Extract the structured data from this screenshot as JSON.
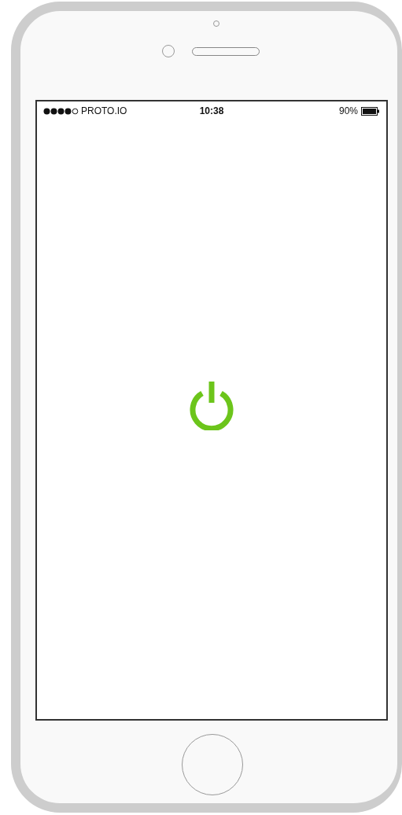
{
  "status_bar": {
    "carrier": "PROTO.IO",
    "time": "10:38",
    "battery": "90%"
  }
}
